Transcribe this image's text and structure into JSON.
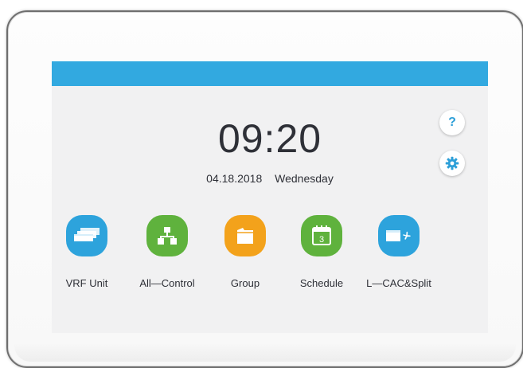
{
  "header": {
    "bar_color": "#32a9e0"
  },
  "clock": {
    "time": "09:20",
    "date": "04.18.2018",
    "weekday": "Wednesday"
  },
  "side_buttons": [
    {
      "name": "help",
      "icon": "question-mark-icon",
      "label": "?"
    },
    {
      "name": "settings",
      "icon": "gear-icon"
    }
  ],
  "apps": [
    {
      "label": "VRF Unit",
      "icon": "vrf-unit-icon",
      "color": "#2da3dc"
    },
    {
      "label": "All—Control",
      "icon": "network-tree-icon",
      "color": "#5fb23d"
    },
    {
      "label": "Group",
      "icon": "folder-icon",
      "color": "#f3a21b"
    },
    {
      "label": "Schedule",
      "icon": "calendar-icon",
      "color": "#5fb23d",
      "badge": "3"
    },
    {
      "label": "L—CAC&Split",
      "icon": "ac-fan-icon",
      "color": "#2da3dc"
    }
  ]
}
